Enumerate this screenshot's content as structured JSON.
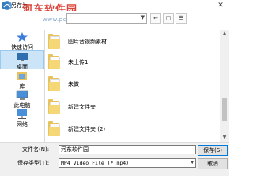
{
  "window": {
    "title": "另存为",
    "close_glyph": "✕"
  },
  "watermark": {
    "text": "河东软件园",
    "url": "www.pc0359.cn"
  },
  "sidebar": {
    "items": [
      {
        "label": "快速访问",
        "icon": "star-icon",
        "selected": false
      },
      {
        "label": "桌面",
        "icon": "desktop-icon",
        "selected": true
      },
      {
        "label": "库",
        "icon": "library-icon",
        "selected": false
      },
      {
        "label": "此电脑",
        "icon": "computer-icon",
        "selected": false
      },
      {
        "label": "网络",
        "icon": "network-icon",
        "selected": false
      }
    ]
  },
  "files": [
    {
      "name": "图片音视频素材",
      "icon": "folder-icon"
    },
    {
      "name": "未上传1",
      "icon": "folder-icon"
    },
    {
      "name": "未做",
      "icon": "folder-icon"
    },
    {
      "name": "新建文件夹",
      "icon": "folder-icon"
    },
    {
      "name": "新建文件夹 (2)",
      "icon": "folder-icon"
    }
  ],
  "form": {
    "filename_label": "文件名(N):",
    "filename_value": "河东软件园",
    "filetype_label": "保存类型(T):",
    "filetype_value": "MP4 Video File (*.mp4)",
    "save_label": "保存(S)",
    "cancel_label": "取消"
  },
  "colors": {
    "selection": "#cce4f7",
    "folder": "#e8c25a",
    "watermark": "#d8342a"
  }
}
